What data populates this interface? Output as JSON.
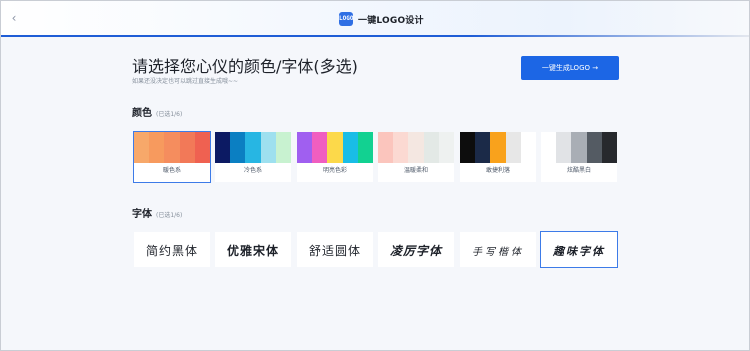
{
  "header": {
    "back_icon": "chevron-left-icon",
    "logo_icon_text": "LOGO",
    "title": "一键LOGO设计",
    "accent": "#1f5dd6"
  },
  "page": {
    "heading": "请选择您心仪的颜色/字体(多选)",
    "subtext": "如果还没决定也可以跳过直接生成哦~~",
    "generate_button": "一键生成LOGO →"
  },
  "colors": {
    "title": "颜色",
    "count": "(已选1/6)",
    "items": [
      {
        "label": "暖色系",
        "selected": true,
        "swatches": [
          "#f7a86a",
          "#f79a5e",
          "#f58d5e",
          "#f27958",
          "#ef6151"
        ]
      },
      {
        "label": "冷色系",
        "selected": false,
        "swatches": [
          "#0c1a63",
          "#0b7fc2",
          "#27b6e3",
          "#9ee0ef",
          "#c8f2d0"
        ]
      },
      {
        "label": "明亮色彩",
        "selected": false,
        "swatches": [
          "#a05ff0",
          "#f05ec0",
          "#fcd94a",
          "#19bde6",
          "#12d191"
        ]
      },
      {
        "label": "温暖柔和",
        "selected": false,
        "swatches": [
          "#fbc5bd",
          "#fbd9d2",
          "#f4e7e1",
          "#e3e9e6",
          "#eef1f0"
        ]
      },
      {
        "label": "敢捷利落",
        "selected": false,
        "swatches": [
          "#0d0d0d",
          "#1b2a48",
          "#f9a21c",
          "#e7e7e7",
          "#ffffff"
        ]
      },
      {
        "label": "炫酷黑白",
        "selected": false,
        "swatches": [
          "#ffffff",
          "#e1e3e6",
          "#a9aeb5",
          "#545b63",
          "#27292d"
        ]
      }
    ]
  },
  "fonts": {
    "title": "字体",
    "count": "(已选1/6)",
    "items": [
      {
        "label": "简约黑体",
        "selected": false
      },
      {
        "label": "优雅宋体",
        "selected": false
      },
      {
        "label": "舒适圆体",
        "selected": false
      },
      {
        "label": "凌厉字体",
        "selected": false
      },
      {
        "label": "手写楷体",
        "selected": false
      },
      {
        "label": "趣味字体",
        "selected": true
      }
    ]
  }
}
